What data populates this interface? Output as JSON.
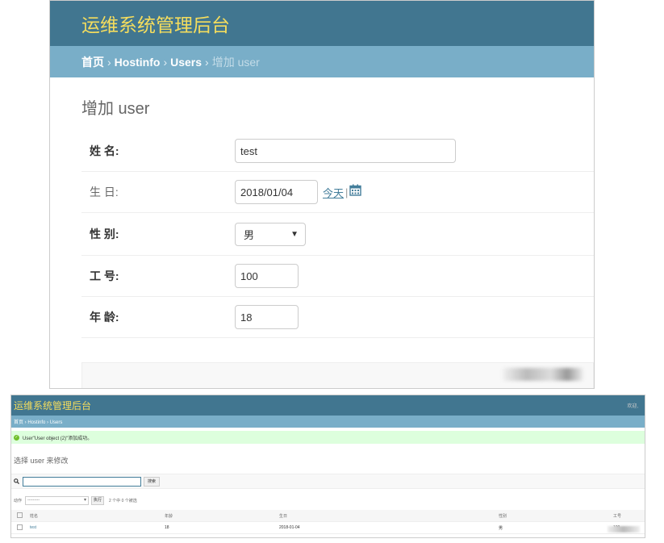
{
  "top": {
    "brand": "运维系统管理后台",
    "breadcrumb": {
      "home": "首页",
      "app": "Hostinfo",
      "model": "Users",
      "current": "增加 user",
      "sep": "›"
    },
    "page_title": "增加 user",
    "fields": {
      "name": {
        "label": "姓 名:",
        "value": "test"
      },
      "birthday": {
        "label": "生 日:",
        "value": "2018/01/04",
        "today": "今天",
        "bar": "|"
      },
      "gender": {
        "label": "性 别:",
        "value": "男",
        "arrow": "▼"
      },
      "job_number": {
        "label": "工 号:",
        "value": "100"
      },
      "age": {
        "label": "年 龄:",
        "value": "18"
      }
    }
  },
  "bottom": {
    "brand": "运维系统管理后台",
    "welcome": "欢迎,",
    "breadcrumb": "首页 › Hostinfo › Users",
    "message": "User\"User object (2)\"添加成功。",
    "title": "选择 user 来修改",
    "search_button": "搜索",
    "action_label": "动作",
    "action_select": "---------",
    "action_go": "执行",
    "selected_count": "2 个中 0 个被选",
    "columns": [
      "姓名",
      "年龄",
      "生日",
      "性别",
      "工号"
    ],
    "rows": [
      {
        "name": "test",
        "age": "18",
        "birthday": "2018-01-04",
        "gender": "男",
        "job": "100"
      }
    ]
  },
  "colors": {
    "header": "#417690",
    "breadcrumb": "#79aec8",
    "brand": "#f5dd5d",
    "link": "#447e9b"
  }
}
